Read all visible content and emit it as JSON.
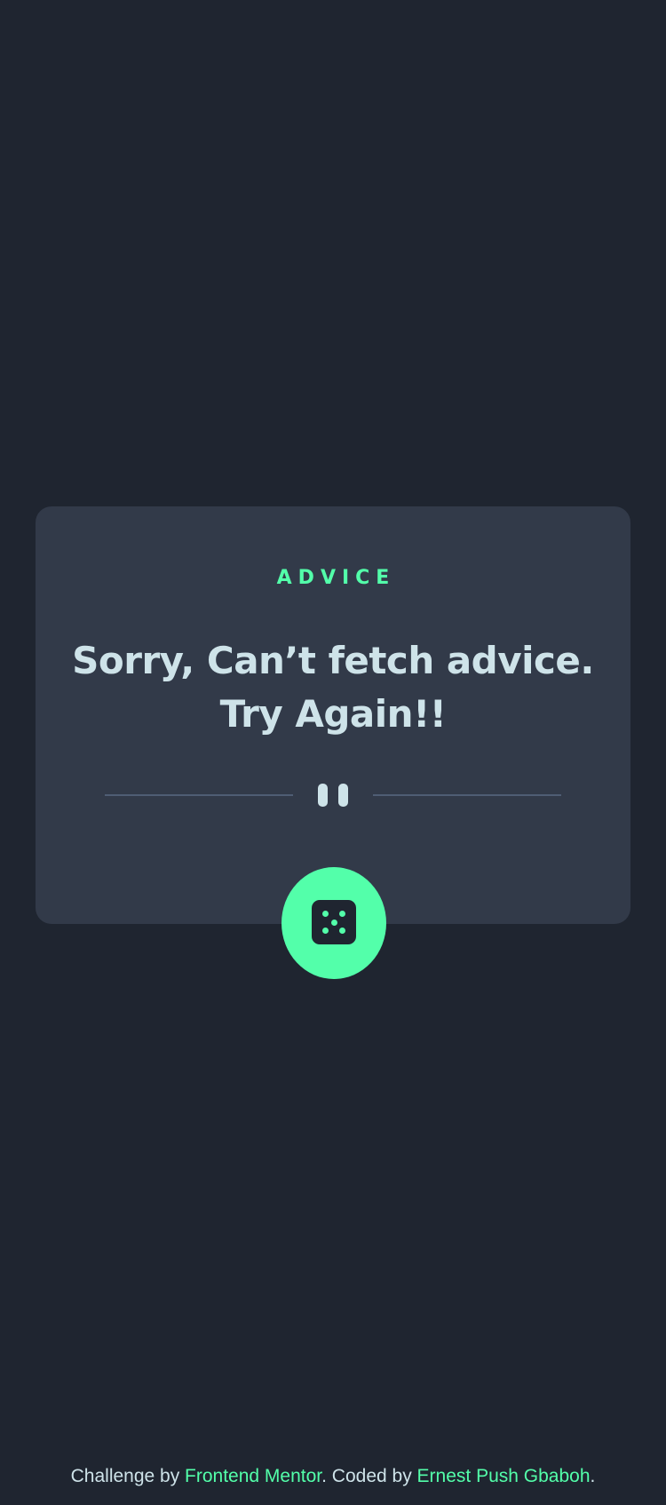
{
  "card": {
    "title": "ADVICE",
    "advice": "Sorry, Can’t fetch advice. Try Again!!"
  },
  "footer": {
    "prefix": "Challenge by ",
    "challenge_link": "Frontend Mentor",
    "middle": ". Coded by ",
    "author_link": "Ernest Push Gbaboh",
    "suffix": "."
  },
  "icons": {
    "divider": "pause-icon",
    "button": "dice-icon"
  },
  "colors": {
    "background": "#1f2530",
    "card": "#323a49",
    "accent": "#53ffaa",
    "text": "#cee3e9",
    "divider": "#4f5d74"
  }
}
